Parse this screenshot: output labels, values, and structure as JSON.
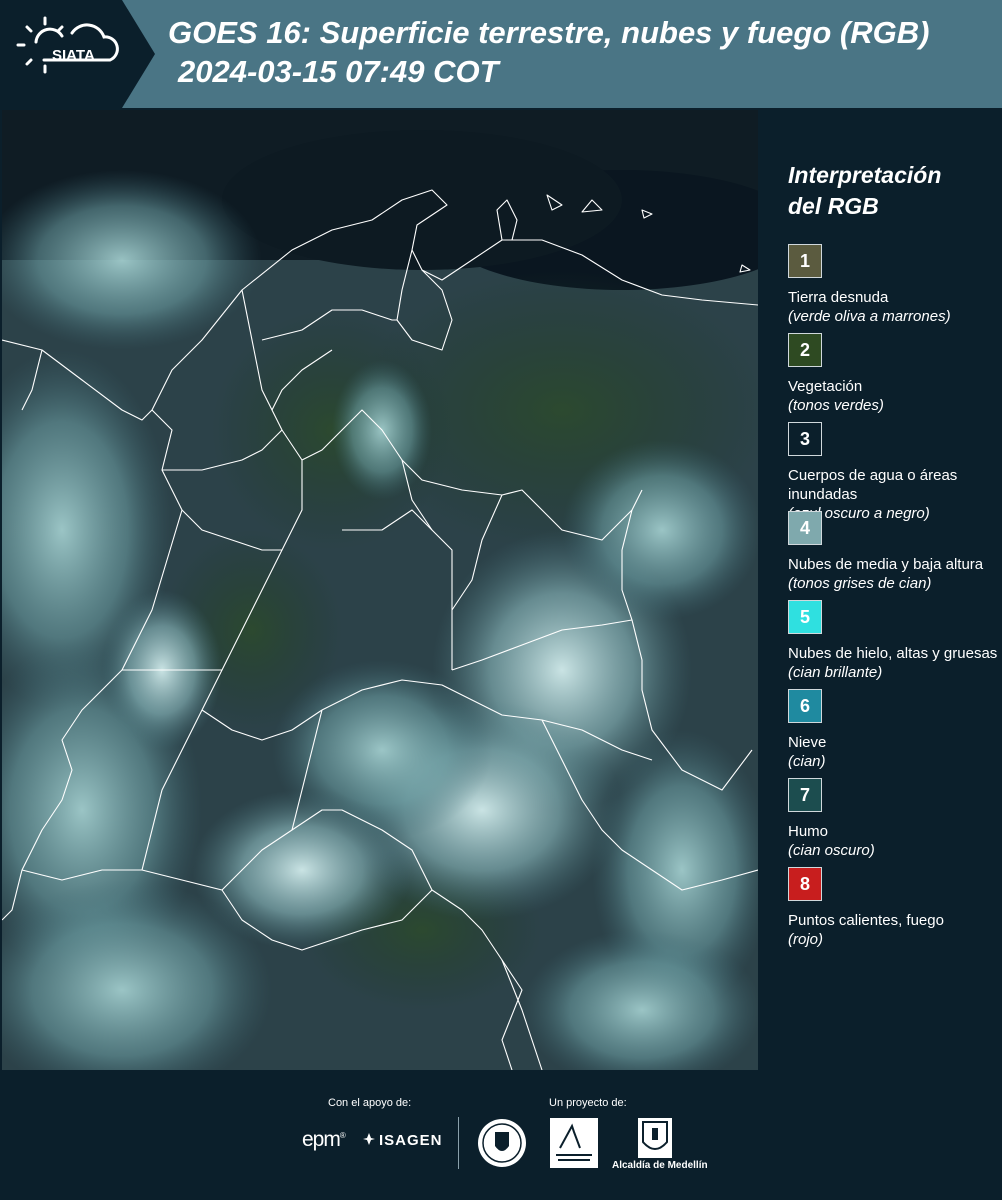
{
  "header": {
    "logo_text": "SIATA",
    "title": "GOES 16: Superficie terrestre, nubes y fuego (RGB)",
    "timestamp": "2024-03-15 07:49 COT",
    "bar_color": "#4a7585",
    "logo_bg_color": "#0b1f2b"
  },
  "map": {
    "description_icon": "satellite-rgb-map",
    "boundary_color": "#ffffff"
  },
  "legend": {
    "title_line1": "Interpretación",
    "title_line2": "del RGB",
    "items": [
      {
        "number": "1",
        "color": "#5b5b3f",
        "label": "Tierra desnuda",
        "sub": "(verde oliva a marrones)"
      },
      {
        "number": "2",
        "color": "#2e4a22",
        "label": "Vegetación",
        "sub": "(tonos verdes)"
      },
      {
        "number": "3",
        "color": "#0b1f2b",
        "label": "Cuerpos de agua o áreas inundadas",
        "sub": "(azul oscuro a negro)"
      },
      {
        "number": "4",
        "color": "#7fa9ad",
        "label": "Nubes de media y baja altura",
        "sub": "(tonos grises de cian)"
      },
      {
        "number": "5",
        "color": "#2fe0e0",
        "label": "Nubes de hielo, altas y gruesas",
        "sub": "(cian brillante)"
      },
      {
        "number": "6",
        "color": "#1f8aa0",
        "label": "Nieve",
        "sub": "(cian)"
      },
      {
        "number": "7",
        "color": "#1c4d4f",
        "label": "Humo",
        "sub": "(cian oscuro)"
      },
      {
        "number": "8",
        "color": "#c81e1e",
        "label": "Puntos calientes, fuego",
        "sub": "(rojo)"
      }
    ]
  },
  "footer": {
    "support_label": "Con el apoyo de:",
    "project_label": "Un proyecto de:",
    "epm_text": "epm",
    "isagen_text": "ISAGEN",
    "alcaldia_text": "Alcaldía de Medellín"
  }
}
